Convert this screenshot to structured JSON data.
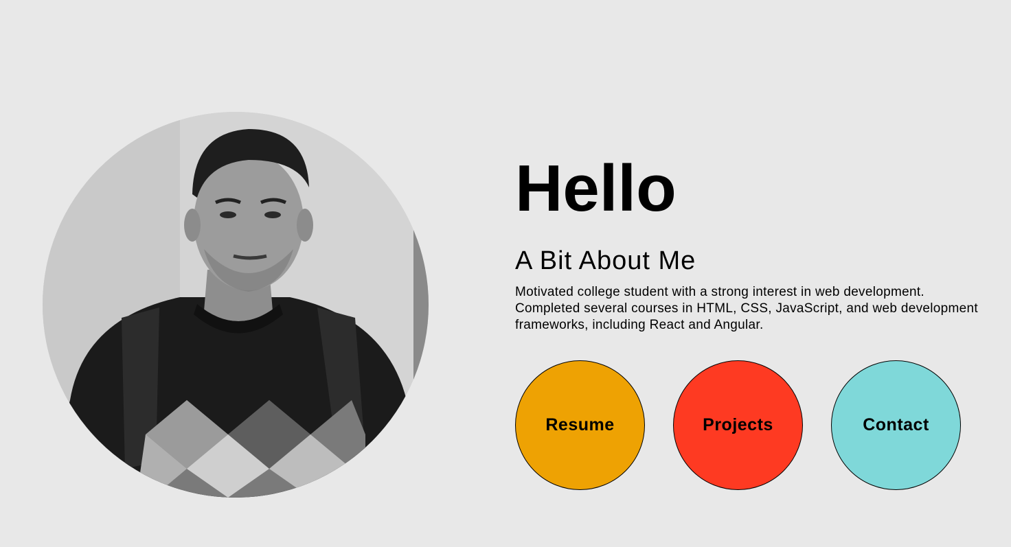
{
  "hero": {
    "greeting": "Hello",
    "subtitle": "A Bit About Me",
    "bio": "Motivated college student with a strong interest in web development. Completed several courses in HTML, CSS, JavaScript, and web development frameworks, including React and Angular."
  },
  "buttons": [
    {
      "label": "Resume",
      "color": "#eea203"
    },
    {
      "label": "Projects",
      "color": "#fe3a22"
    },
    {
      "label": "Contact",
      "color": "#7fd8d9"
    }
  ],
  "colors": {
    "background": "#e8e8e8",
    "text": "#000000"
  },
  "avatar": {
    "icon": "profile-photo"
  }
}
